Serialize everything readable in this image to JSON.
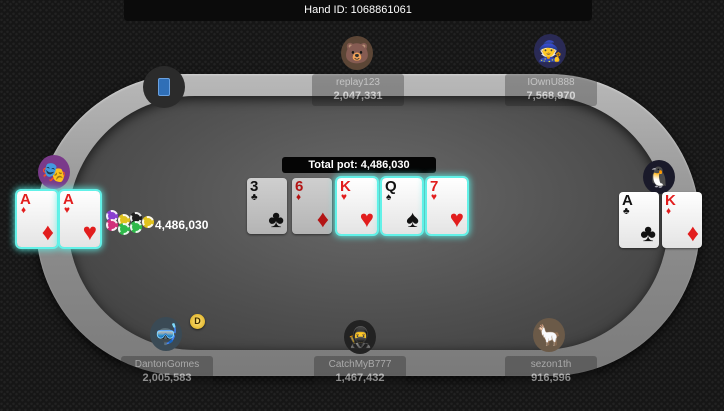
{
  "hand": {
    "label": "Hand ID: 1068861061"
  },
  "pot": {
    "label": "Total pot: 4,486,030"
  },
  "board": [
    {
      "rank": "3",
      "suit": "♣",
      "color": "black",
      "state": "greyed"
    },
    {
      "rank": "6",
      "suit": "♦",
      "color": "red",
      "state": "greyed"
    },
    {
      "rank": "K",
      "suit": "♥",
      "color": "red",
      "state": "highlight"
    },
    {
      "rank": "Q",
      "suit": "♠",
      "color": "black",
      "state": "highlight"
    },
    {
      "rank": "7",
      "suit": "♥",
      "color": "red",
      "state": "highlight"
    }
  ],
  "players": {
    "top_left": {
      "name": "replay123",
      "stack": "2,047,331",
      "avatar": "bear-avatar-icon"
    },
    "top_right": {
      "name": "IOwnU888",
      "stack": "7,568,970",
      "avatar": "wizard-avatar-icon"
    },
    "bottom_left": {
      "name": "DantonGomes",
      "stack": "2,005,583",
      "avatar": "diver-avatar-icon"
    },
    "bottom_mid": {
      "name": "CatchMyB777",
      "stack": "1,467,432",
      "avatar": "ninja-avatar-icon"
    },
    "bottom_right": {
      "name": "sezon1th",
      "stack": "916,596",
      "avatar": "llama-avatar-icon"
    }
  },
  "hero": {
    "cards": [
      {
        "rank": "A",
        "suit": "♦",
        "color": "red"
      },
      {
        "rank": "A",
        "suit": "♥",
        "color": "red"
      }
    ],
    "bet": "4,486,030",
    "avatar": "carnival-avatar-icon"
  },
  "villain": {
    "cards": [
      {
        "rank": "A",
        "suit": "♣",
        "color": "black"
      },
      {
        "rank": "K",
        "suit": "♦",
        "color": "red"
      }
    ],
    "avatar": "penguin-avatar-icon"
  },
  "dealer": {
    "label": "D"
  },
  "empty_seat": {
    "icon": "phone-icon"
  },
  "colors": {
    "glow": "#6ff3ea",
    "felt": "#505050",
    "rail": "#9a9a9a"
  }
}
